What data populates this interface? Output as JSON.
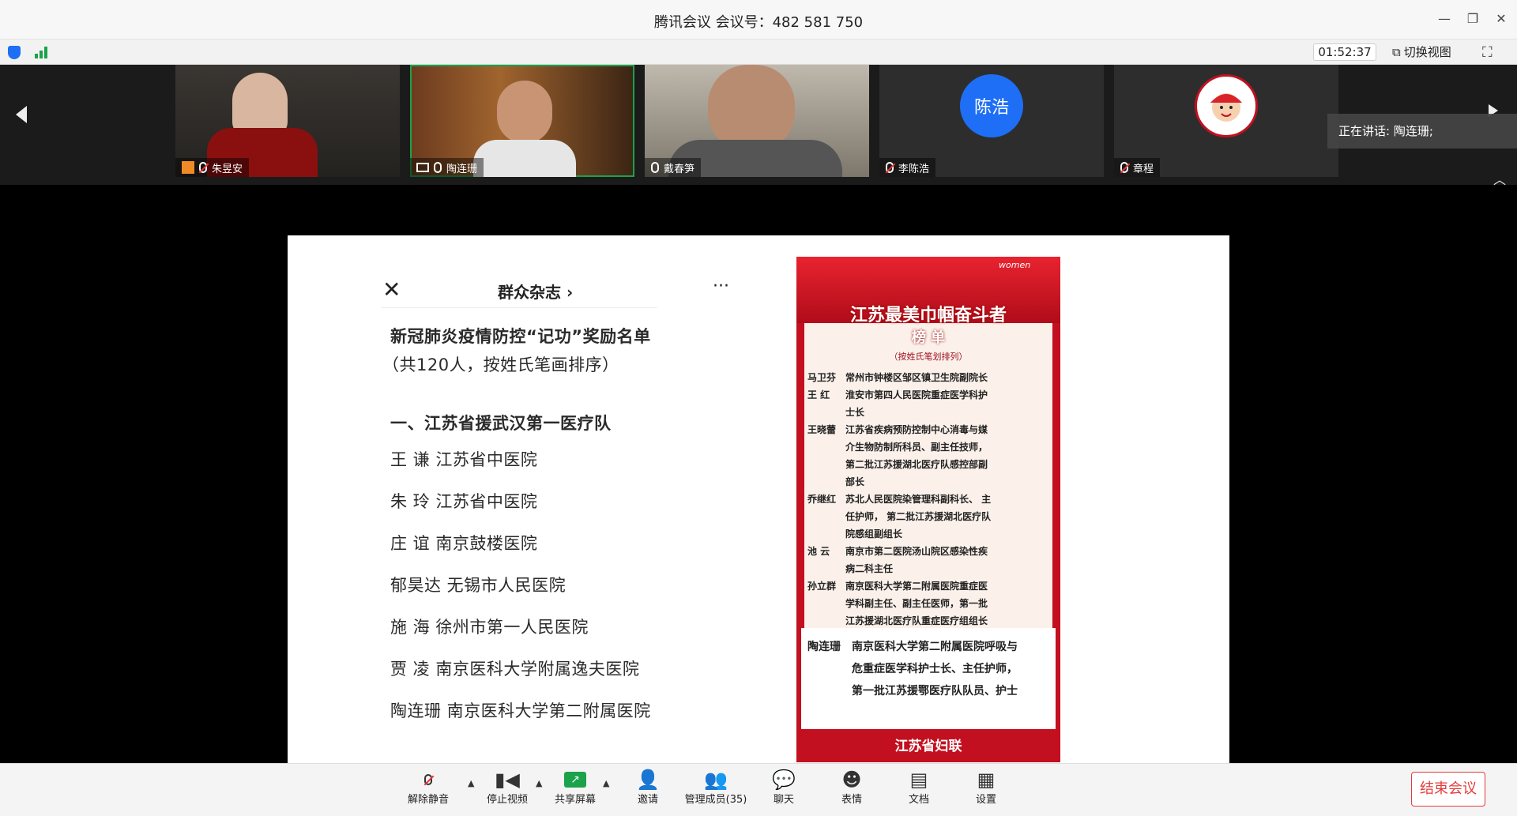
{
  "window": {
    "title": "腾讯会议 会议号：482 581 750"
  },
  "status": {
    "timer": "01:52:37",
    "switch_view": "切换视图"
  },
  "participants": [
    {
      "name": "朱昱安",
      "muted": true
    },
    {
      "name": "陶连珊",
      "muted": false,
      "active": true
    },
    {
      "name": "戴春笋",
      "muted": false
    },
    {
      "name": "李陈浩",
      "muted": true,
      "avatar_text": "陈浩",
      "avatar_color": "#1e6ff5"
    },
    {
      "name": "章程",
      "muted": true
    }
  ],
  "speaking": {
    "label": "正在讲话: 陶连珊;"
  },
  "shared": {
    "phone_title": "群众杂志",
    "article": {
      "heading": "新冠肺炎疫情防控“记功”奖励名单",
      "subheading": "（共120人，按姓氏笔画排序）",
      "section": "一、江苏省援武汉第一医疗队",
      "rows": [
        "王  谦 江苏省中医院",
        "朱  玲 江苏省中医院",
        "庄  谊 南京鼓楼医院",
        "郁昊达 无锡市人民医院",
        "施  海 徐州市第一人民医院",
        "贾  凌 南京医科大学附属逸夫医院",
        "陶连珊 南京医科大学第二附属医院"
      ]
    },
    "poster": {
      "brand": "women",
      "title": "江苏最美巾帼奋斗者",
      "title2": "榜 单",
      "note": "（按姓氏笔划排列）",
      "entries": [
        {
          "name": "马卫芬",
          "desc": [
            "常州市钟楼区邹区镇卫生院副院长"
          ]
        },
        {
          "name": "王  红",
          "desc": [
            "淮安市第四人民医院重症医学科护",
            "士长"
          ]
        },
        {
          "name": "王晓蕾",
          "desc": [
            "江苏省疾病预防控制中心消毒与媒",
            "介生物防制所科员、副主任技师，",
            "第二批江苏援湖北医疗队感控部副",
            "部长"
          ]
        },
        {
          "name": "乔继红",
          "desc": [
            "苏北人民医院染管理科副科长、 主",
            "任护师， 第二批江苏援湖北医疗队",
            "院感组副组长"
          ]
        },
        {
          "name": "池  云",
          "desc": [
            "南京市第二医院汤山院区感染性疾",
            "病二科主任"
          ]
        },
        {
          "name": "孙立群",
          "desc": [
            "南京医科大学第二附属医院重症医",
            "学科副主任、副主任医师，第一批",
            "江苏援湖北医疗队重症医疗组组长"
          ]
        }
      ],
      "highlight": {
        "name": "陶连珊",
        "desc": [
          "南京医科大学第二附属医院呼吸与",
          "危重症医学科护士长、主任护师，",
          "第一批江苏援鄂医疗队队员、护士"
        ]
      },
      "footer": "江苏省妇联"
    }
  },
  "toolbar": {
    "unmute": "解除静音",
    "stop_video": "停止视频",
    "share_screen": "共享屏幕",
    "invite": "邀请",
    "manage": "管理成员(35)",
    "chat": "聊天",
    "emoji": "表情",
    "docs": "文档",
    "settings": "设置",
    "end": "结束会议"
  }
}
